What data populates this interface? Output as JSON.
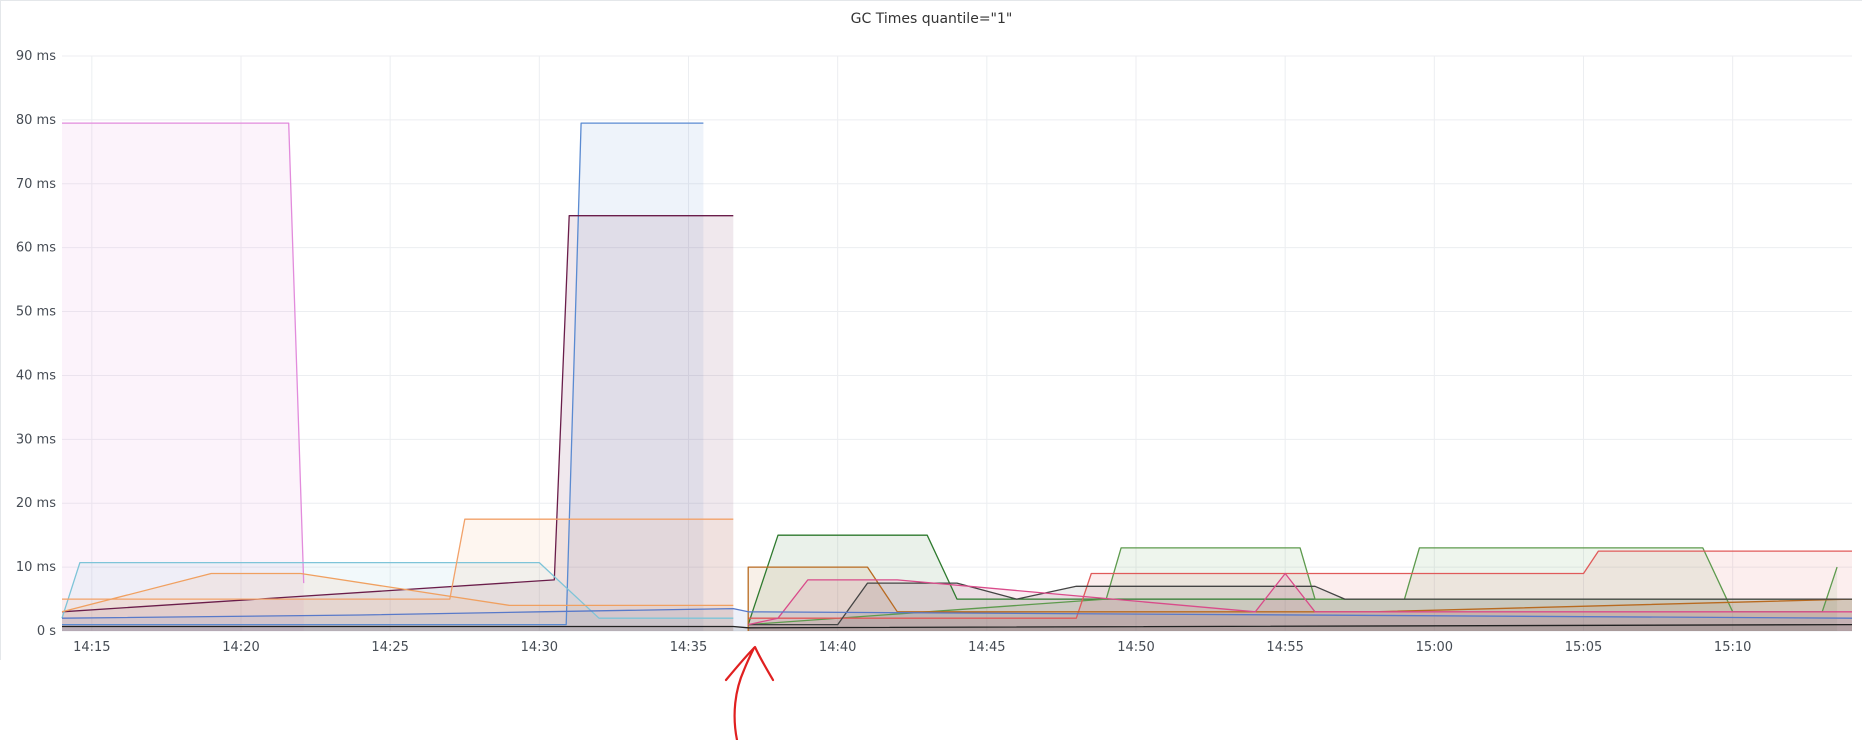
{
  "panel": {
    "title": "GC Times quantile=\"1\""
  },
  "chart_data": {
    "type": "area",
    "title": "GC Times quantile=\"1\"",
    "xlabel": "",
    "ylabel": "",
    "ylim": [
      0,
      90
    ],
    "yunit": "ms",
    "y_ticks": [
      "0 s",
      "10 ms",
      "20 ms",
      "30 ms",
      "40 ms",
      "50 ms",
      "60 ms",
      "70 ms",
      "80 ms",
      "90 ms"
    ],
    "x_ticks": [
      "14:15",
      "14:20",
      "14:25",
      "14:30",
      "14:35",
      "14:40",
      "14:45",
      "14:50",
      "14:55",
      "15:00",
      "15:05",
      "15:10"
    ],
    "xlim": [
      "14:14",
      "15:14"
    ],
    "grid": true,
    "legend": "none",
    "colors": {
      "grid": "#eceef1",
      "annotation": "#e02020"
    },
    "series": [
      {
        "color": "#e28bdc",
        "x": [
          "14:14",
          "14:21.6",
          "14:22.1"
        ],
        "y": [
          79.5,
          79.5,
          7.5
        ]
      },
      {
        "color": "#5a8ad1",
        "x": [
          "14:14",
          "14:30.9",
          "14:31.4",
          "14:35.5"
        ],
        "y": [
          1,
          1,
          79.5,
          79.5
        ]
      },
      {
        "color": "#6a1d4a",
        "x": [
          "14:14",
          "14:30.5",
          "14:31",
          "14:36.5"
        ],
        "y": [
          3,
          8,
          65,
          65
        ]
      },
      {
        "color": "#7ec4d8",
        "x": [
          "14:14",
          "14:14.6",
          "14:30",
          "14:32",
          "14:36.5"
        ],
        "y": [
          2,
          10.7,
          10.7,
          2,
          2
        ]
      },
      {
        "color": "#f2a26a",
        "x": [
          "14:14",
          "14:27",
          "14:27.5",
          "14:36.5"
        ],
        "y": [
          5,
          5,
          17.5,
          17.5
        ]
      },
      {
        "color": "#f0a060",
        "x": [
          "14:14",
          "14:19",
          "14:22",
          "14:29",
          "14:36.5"
        ],
        "y": [
          3,
          9,
          9,
          4,
          4
        ]
      },
      {
        "color": "#2e7a2e",
        "x": [
          "14:37",
          "14:38",
          "14:43",
          "14:44",
          "14:58",
          "15:10",
          "15:14"
        ],
        "y": [
          1,
          15,
          15,
          5,
          5,
          5,
          5
        ]
      },
      {
        "color": "#5d9a4d",
        "x": [
          "14:37",
          "14:49",
          "14:49.5",
          "14:55.5",
          "14:56",
          "14:59",
          "14:59.5",
          "15:09",
          "15:10",
          "15:13",
          "15:13.5"
        ],
        "y": [
          1,
          5,
          13,
          13,
          5,
          5,
          13,
          13,
          3,
          3,
          10
        ]
      },
      {
        "color": "#e05a5a",
        "x": [
          "14:37",
          "14:48",
          "14:48.5",
          "15:05",
          "15:05.5",
          "15:14"
        ],
        "y": [
          2,
          2,
          9,
          9,
          12.5,
          12.5
        ]
      },
      {
        "color": "#b86a20",
        "x": [
          "14:37",
          "14:37",
          "14:41",
          "14:42",
          "14:58",
          "15:14"
        ],
        "y": [
          0,
          10,
          10,
          3,
          3,
          5
        ]
      },
      {
        "color": "#444444",
        "x": [
          "14:37",
          "14:40",
          "14:41",
          "14:44",
          "14:46",
          "14:48",
          "14:56",
          "14:57",
          "15:14"
        ],
        "y": [
          1,
          1,
          7.5,
          7.5,
          5,
          7,
          7,
          5,
          5
        ]
      },
      {
        "color": "#d94b8a",
        "x": [
          "14:37",
          "14:38",
          "14:39",
          "14:42",
          "14:54",
          "14:55",
          "14:56",
          "15:14"
        ],
        "y": [
          1,
          2,
          8,
          8,
          3,
          9,
          3,
          3
        ]
      },
      {
        "color": "#5879c9",
        "x": [
          "14:14",
          "14:24",
          "14:30",
          "14:36.5",
          "14:37",
          "15:14"
        ],
        "y": [
          2,
          2.5,
          3,
          3.5,
          3,
          2
        ]
      },
      {
        "color": "#222222",
        "x": [
          "14:14",
          "14:36.5",
          "14:37",
          "15:14"
        ],
        "y": [
          0.7,
          0.7,
          0.5,
          1
        ]
      }
    ]
  }
}
